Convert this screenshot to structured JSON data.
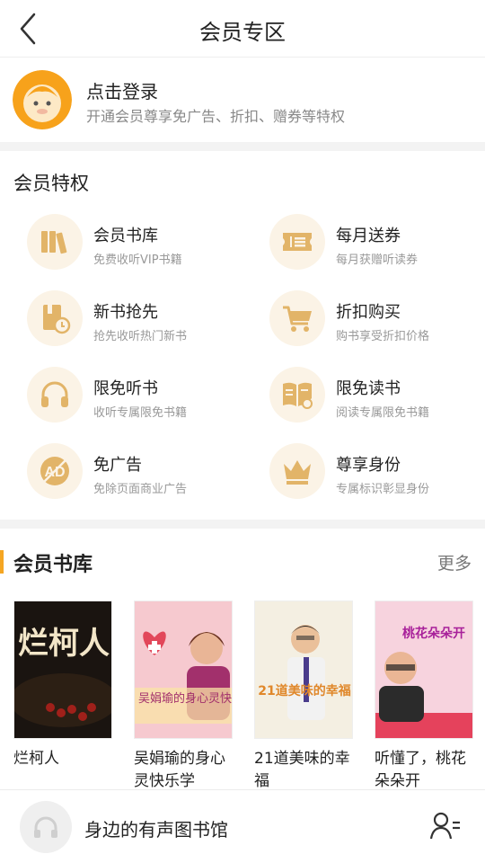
{
  "header": {
    "title": "会员专区"
  },
  "login": {
    "title": "点击登录",
    "subtitle": "开通会员尊享免广告、折扣、赠券等特权"
  },
  "privileges": {
    "title": "会员特权",
    "items": [
      {
        "name": "会员书库",
        "desc": "免费收听VIP书籍",
        "icon": "books-icon"
      },
      {
        "name": "每月送券",
        "desc": "每月获赠听读券",
        "icon": "ticket-icon"
      },
      {
        "name": "新书抢先",
        "desc": "抢先收听热门新书",
        "icon": "new-book-clock-icon"
      },
      {
        "name": "折扣购买",
        "desc": "购书享受折扣价格",
        "icon": "cart-icon"
      },
      {
        "name": "限免听书",
        "desc": "收听专属限免书籍",
        "icon": "headphones-icon"
      },
      {
        "name": "限免读书",
        "desc": "阅读专属限免书籍",
        "icon": "open-book-icon"
      },
      {
        "name": "免广告",
        "desc": "免除页面商业广告",
        "icon": "no-ad-icon"
      },
      {
        "name": "尊享身份",
        "desc": "专属标识彰显身份",
        "icon": "crown-icon"
      }
    ]
  },
  "library": {
    "title": "会员书库",
    "more": "更多",
    "books": [
      {
        "title": "烂柯人",
        "cover_text": "烂柯人"
      },
      {
        "title": "吴娟瑜的身心灵快乐学",
        "cover_text": "吴娟瑜的身心灵快乐学"
      },
      {
        "title": "21道美味的幸福",
        "cover_text": "21道美味的幸福"
      },
      {
        "title": "听懂了，桃花朵朵开",
        "cover_text": "桃花朵朵开"
      }
    ]
  },
  "bottom": {
    "text": "身边的有声图书馆"
  },
  "colors": {
    "accent": "#f5a623",
    "icon_bg": "#fbf3e6",
    "icon_fg": "#e2b468"
  }
}
